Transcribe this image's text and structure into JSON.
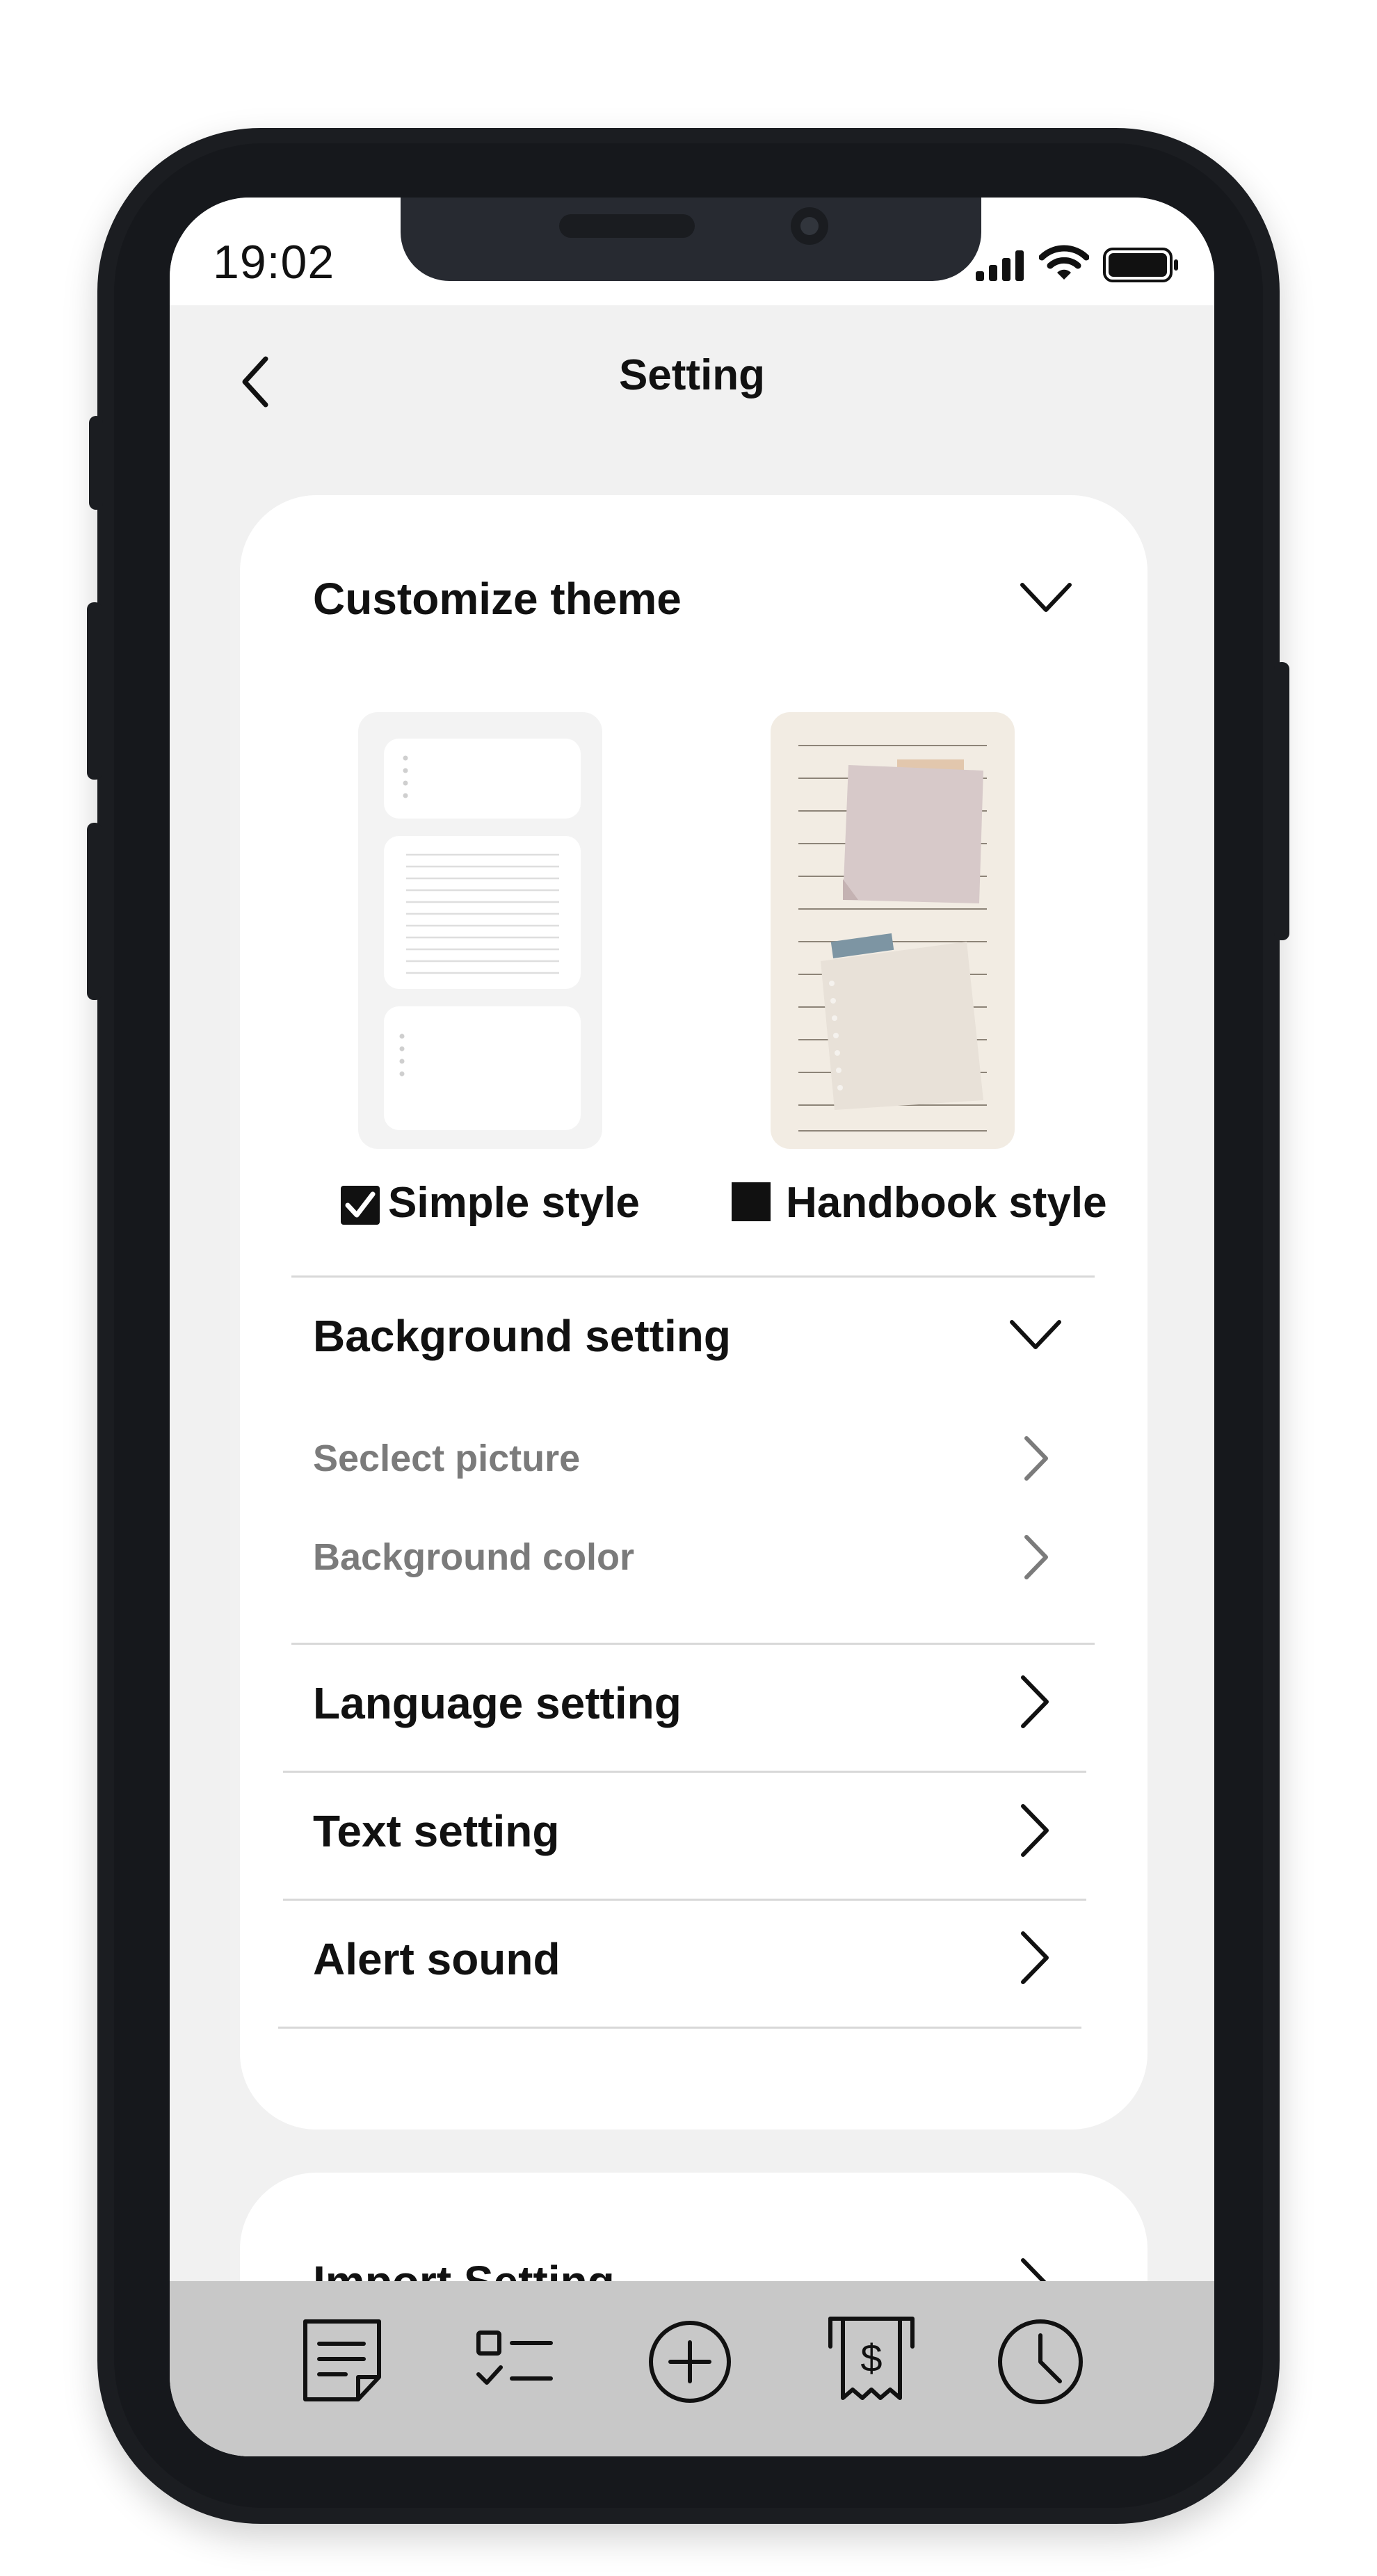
{
  "status_bar": {
    "time": "19:02"
  },
  "header": {
    "title": "Setting"
  },
  "theme": {
    "title": "Customize theme",
    "options": [
      {
        "label": "Simple style",
        "checked": true
      },
      {
        "label": "Handbook style",
        "checked": false
      }
    ]
  },
  "background": {
    "title": "Background setting",
    "items": [
      {
        "label": "Seclect picture"
      },
      {
        "label": "Background color"
      }
    ]
  },
  "settings_rows": [
    {
      "label": "Language setting"
    },
    {
      "label": "Text setting"
    },
    {
      "label": "Alert sound"
    }
  ],
  "second_card": {
    "first_row": "Import Setting"
  },
  "tab_bar": {
    "icons": [
      "note-icon",
      "checklist-icon",
      "add-circle-icon",
      "receipt-dollar-icon",
      "clock-icon"
    ]
  },
  "colors": {
    "frame": "#1b1d21",
    "screen_bg": "#f1f1f1",
    "card_bg": "#ffffff",
    "tab_bar_bg": "#c8c8c8",
    "muted_text": "#7b7b7b"
  }
}
